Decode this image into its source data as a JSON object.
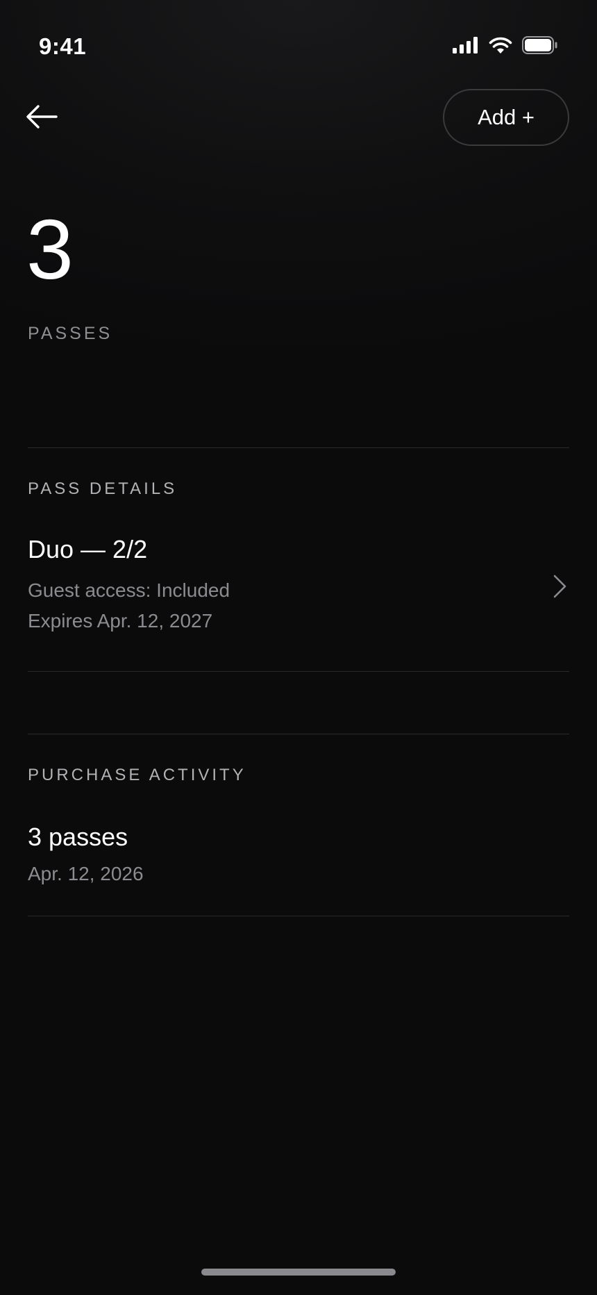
{
  "status_bar": {
    "time": "9:41",
    "icons": [
      "cellular-signal-icon",
      "wifi-icon",
      "battery-icon"
    ]
  },
  "header": {
    "back_icon": "arrow-left-icon",
    "add_label": "Add +"
  },
  "summary": {
    "count": "3",
    "label": "PASSES"
  },
  "pass_details": {
    "section_label": "PASS DETAILS",
    "title": "Duo — 2/2",
    "guest_access": "Guest access: Included",
    "expires": "Expires Apr. 12, 2027",
    "chevron_icon": "chevron-right-icon"
  },
  "purchase_activity": {
    "section_label": "PURCHASE ACTIVITY",
    "title": "3 passes",
    "date": "Apr. 12, 2026"
  },
  "colors": {
    "background": "#0b0b0c",
    "text_primary": "#ffffff",
    "text_secondary": "#8c8c90",
    "divider": "#2a2a2d"
  }
}
